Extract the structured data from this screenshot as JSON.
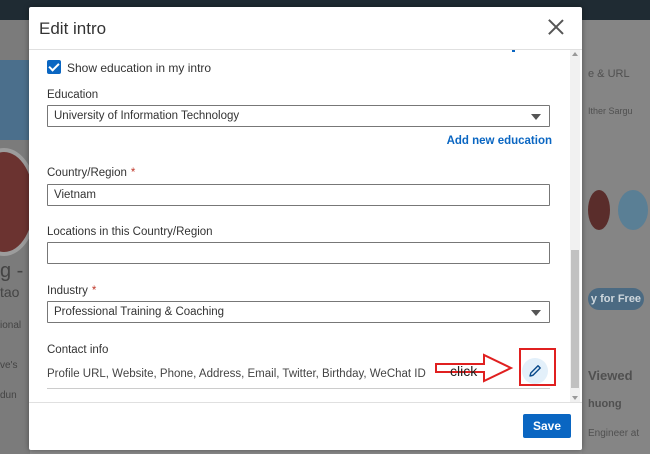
{
  "modal": {
    "title": "Edit intro",
    "show_education_label": "Show education in my intro",
    "show_education_checked": true,
    "education": {
      "label": "Education",
      "value": "University of Information Technology"
    },
    "add_education_link": "Add new education",
    "country": {
      "label": "Country/Region",
      "required_mark": "*",
      "value": "Vietnam"
    },
    "locations": {
      "label": "Locations in this Country/Region",
      "value": ""
    },
    "industry": {
      "label": "Industry",
      "required_mark": "*",
      "value": "Professional Training & Coaching"
    },
    "contact": {
      "label": "Contact info",
      "summary": "Profile URL, Website, Phone, Address, Email, Twitter, Birthday, WeChat ID"
    },
    "save_label": "Save"
  },
  "annotation": {
    "text": "click",
    "color": "#e02020"
  },
  "background": {
    "left_texts": [
      "g - S",
      "tao",
      "ional",
      "ve's",
      "dun"
    ],
    "right_texts": [
      "e & URL",
      "Ither Sargu",
      "Viewed",
      "huong",
      "Engineer at"
    ],
    "right_button": "y for Free"
  },
  "colors": {
    "accent": "#0a66c2",
    "annotation": "#e02020"
  }
}
